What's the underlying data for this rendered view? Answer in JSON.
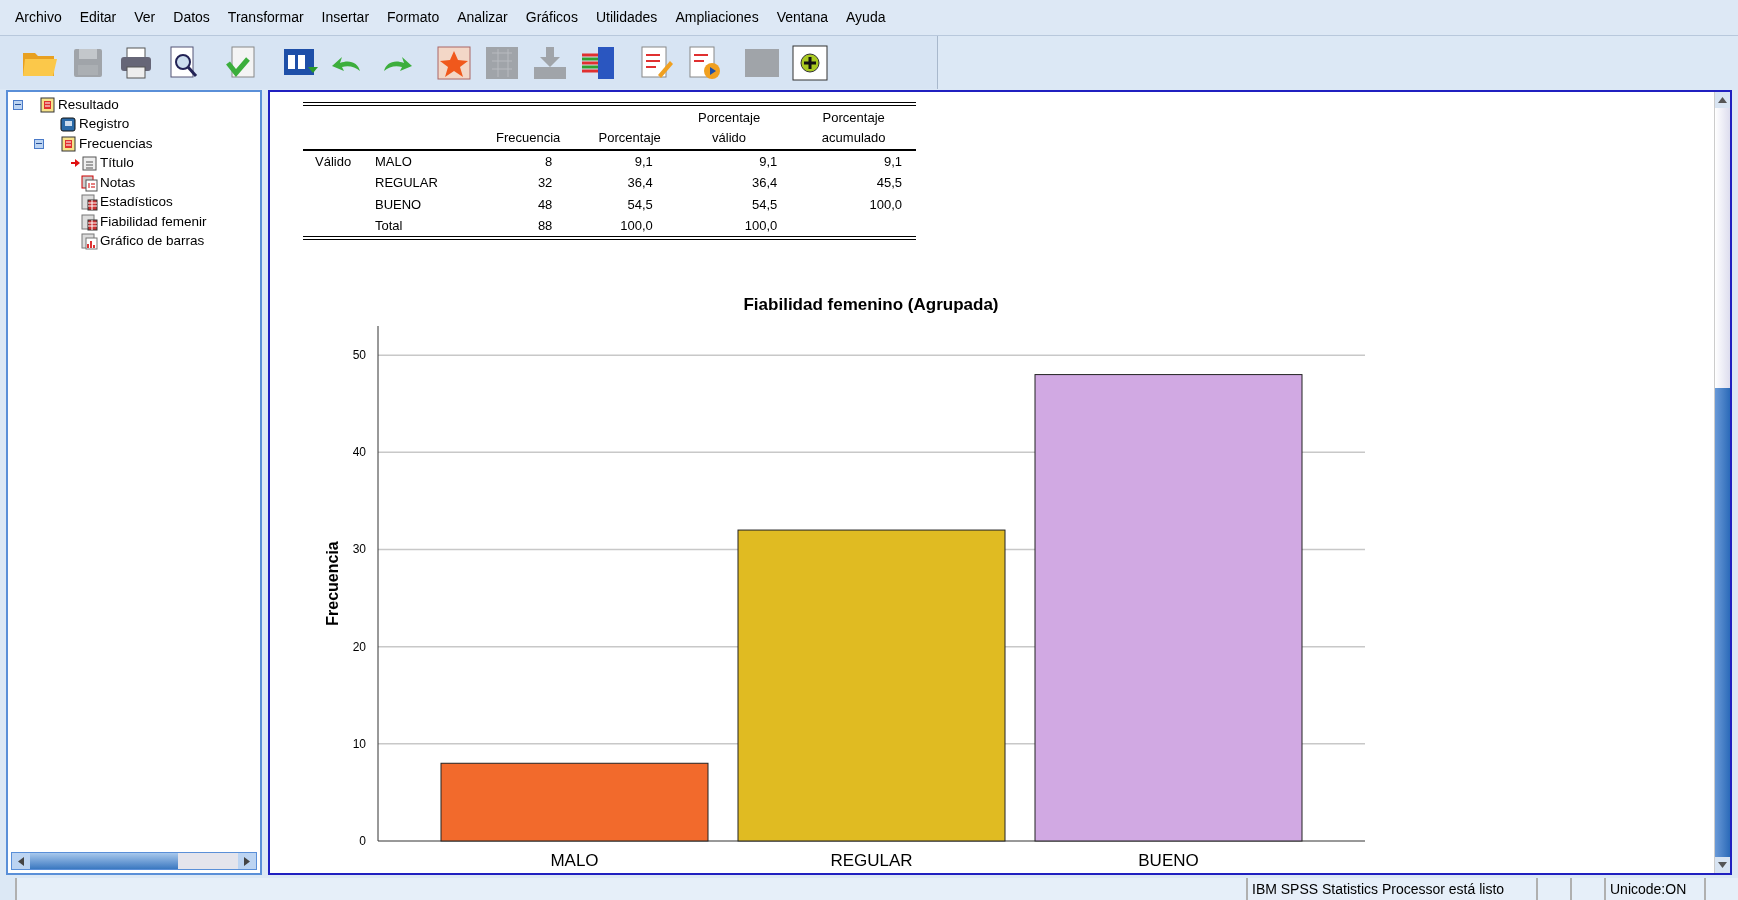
{
  "menu": [
    "Archivo",
    "Editar",
    "Ver",
    "Datos",
    "Transformar",
    "Insertar",
    "Formato",
    "Analizar",
    "Gráficos",
    "Utilidades",
    "Ampliaciones",
    "Ventana",
    "Ayuda"
  ],
  "toolbar": [
    {
      "disabled": false
    },
    {
      "disabled": true
    },
    {
      "disabled": false
    },
    {
      "disabled": false
    },
    {
      "disabled": false
    },
    {
      "disabled": false
    },
    {
      "disabled": false
    },
    {
      "disabled": false
    },
    {
      "disabled": false
    },
    {
      "disabled": true
    },
    {
      "disabled": true
    },
    {
      "disabled": false
    },
    {
      "disabled": false
    },
    {
      "disabled": false
    },
    {
      "disabled": true
    },
    {
      "disabled": false
    }
  ],
  "outline": [
    {
      "label": "Resultado",
      "kind": "output",
      "expanded": true,
      "current": false,
      "children": [
        {
          "label": "Registro",
          "kind": "log",
          "current": false
        },
        {
          "label": "Frecuencias",
          "kind": "output",
          "expanded": true,
          "current": false,
          "children": [
            {
              "label": "Título",
              "kind": "title",
              "current": true
            },
            {
              "label": "Notas",
              "kind": "notes",
              "current": false
            },
            {
              "label": "Estadísticos",
              "kind": "table",
              "current": false
            },
            {
              "label": "Fiabilidad femenir",
              "kind": "table",
              "current": false
            },
            {
              "label": "Gráfico de barras",
              "kind": "chart",
              "current": false
            }
          ]
        }
      ]
    }
  ],
  "table": {
    "columns": [
      "Frecuencia",
      "Porcentaje",
      "Porcentaje válido",
      "Porcentaje acumulado"
    ],
    "group": "Válido",
    "rows": [
      {
        "label": "MALO",
        "cells": [
          "8",
          "9,1",
          "9,1",
          "9,1"
        ]
      },
      {
        "label": "REGULAR",
        "cells": [
          "32",
          "36,4",
          "36,4",
          "45,5"
        ]
      },
      {
        "label": "BUENO",
        "cells": [
          "48",
          "54,5",
          "54,5",
          "100,0"
        ]
      },
      {
        "label": "Total",
        "cells": [
          "88",
          "100,0",
          "100,0",
          ""
        ]
      }
    ]
  },
  "chart_data": {
    "type": "bar",
    "title": "Fiabilidad femenino (Agrupada)",
    "ylabel": "Frecuencia",
    "categories": [
      "MALO",
      "REGULAR",
      "BUENO"
    ],
    "series": [
      {
        "color": "#f26a2c",
        "values": [
          8,
          null,
          null
        ]
      },
      {
        "color": "#e0bb22",
        "values": [
          null,
          32,
          null
        ]
      },
      {
        "color": "#d1a9e3",
        "values": [
          null,
          null,
          48
        ]
      }
    ],
    "grid": true,
    "ylim": [
      0,
      53
    ],
    "yticks": [
      0,
      10,
      20,
      30,
      40,
      50
    ]
  },
  "status_bar": {
    "message": "IBM SPSS Statistics Processor está listo",
    "encoding": "Unicode:ON"
  }
}
